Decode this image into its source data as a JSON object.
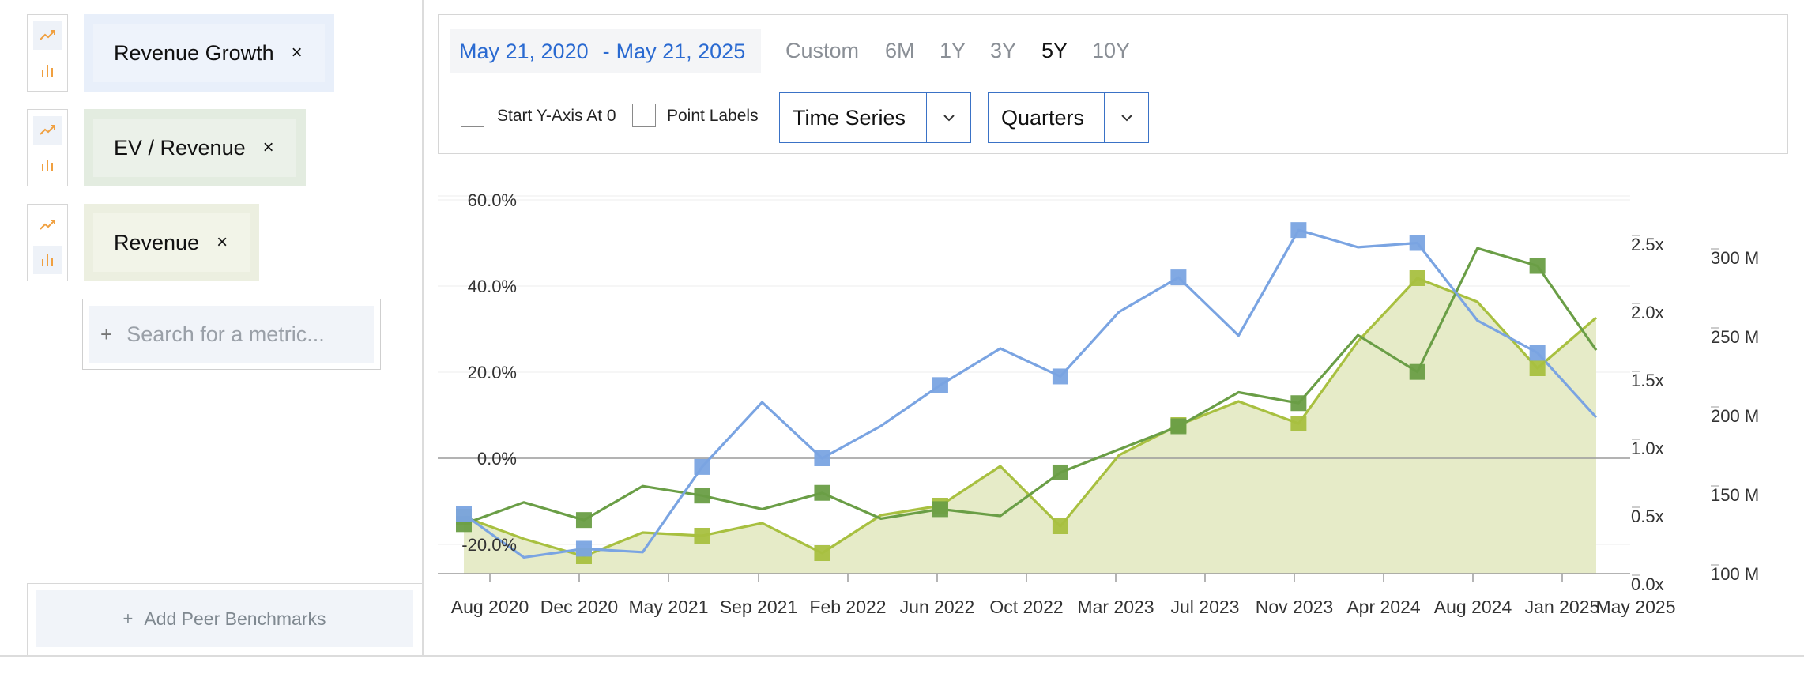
{
  "sidebar": {
    "metrics": [
      {
        "label": "Revenue Growth",
        "chip_bg": "#e8effa",
        "chip_inner": "#eef3fb",
        "close": "×"
      },
      {
        "label": "EV / Revenue",
        "chip_bg": "#e3ece0",
        "chip_inner": "#ebf1e9",
        "close": "×"
      },
      {
        "label": "Revenue",
        "chip_bg": "#ecefe0",
        "chip_inner": "#f2f4e8",
        "close": "×"
      }
    ],
    "search_placeholder": "Search for a metric...",
    "search_plus": "+",
    "peer_label": "Add Peer Benchmarks",
    "peer_plus": "+"
  },
  "controls": {
    "date_start": "May 21, 2020",
    "date_sep": "-",
    "date_end": "May 21, 2025",
    "periods": [
      "Custom",
      "6M",
      "1Y",
      "3Y",
      "5Y",
      "10Y"
    ],
    "active_period": "5Y",
    "start_y_axis_label": "Start Y-Axis At 0",
    "point_labels_label": "Point Labels",
    "chart_mode": "Time Series",
    "frequency": "Quarters"
  },
  "chart_data": {
    "type": "line",
    "x": [
      "2020-06-30",
      "2020-09-30",
      "2020-12-31",
      "2021-03-31",
      "2021-06-30",
      "2021-09-30",
      "2021-12-31",
      "2022-03-31",
      "2022-06-30",
      "2022-09-30",
      "2022-12-31",
      "2023-03-31",
      "2023-06-30",
      "2023-09-30",
      "2023-12-31",
      "2024-03-31",
      "2024-06-30",
      "2024-09-30",
      "2024-12-31",
      "2025-03-31"
    ],
    "x_ticks": [
      "Aug 2020",
      "Dec 2020",
      "May 2021",
      "Sep 2021",
      "Feb 2022",
      "Jun 2022",
      "Oct 2022",
      "Mar 2023",
      "Jul 2023",
      "Nov 2023",
      "Apr 2024",
      "Aug 2024",
      "Jan 2025",
      "May 2025"
    ],
    "series": [
      {
        "name": "Revenue Growth",
        "axis": "left",
        "color": "#7aa4e2",
        "values": [
          -13.0,
          -23.0,
          -21.0,
          -21.8,
          -2.0,
          13.0,
          0.0,
          7.5,
          17.0,
          25.5,
          19.0,
          34.0,
          42.0,
          28.5,
          53.0,
          49.0,
          50.0,
          32.0,
          24.5,
          9.5
        ]
      },
      {
        "name": "EV / Revenue",
        "axis": "right_x",
        "color": "#6a9e46",
        "values": [
          0.44,
          0.6,
          0.47,
          0.72,
          0.65,
          0.55,
          0.67,
          0.48,
          0.55,
          0.5,
          0.82,
          0.99,
          1.16,
          1.41,
          1.33,
          1.83,
          1.56,
          2.47,
          2.34,
          1.72
        ]
      },
      {
        "name": "Revenue",
        "axis": "right_m",
        "color": "#a8c040",
        "fill": "#e6ebc8",
        "values": [
          136,
          122,
          111,
          126,
          124,
          132,
          113,
          137,
          143,
          168,
          130,
          175,
          194,
          209,
          195,
          247,
          287,
          272,
          230,
          262
        ]
      }
    ],
    "left_axis": {
      "ticks": [
        "60.0%",
        "40.0%",
        "20.0%",
        "0.0%",
        "-20.0%"
      ],
      "values": [
        60,
        40,
        20,
        0,
        -20
      ],
      "ylim": [
        -26,
        61
      ]
    },
    "right_axis_x": {
      "ticks": [
        "2.5x",
        "2.0x",
        "1.5x",
        "1.0x",
        "0.5x",
        "0.0x"
      ],
      "values": [
        2.5,
        2.0,
        1.5,
        1.0,
        0.5,
        0.0
      ]
    },
    "right_axis_m": {
      "ticks": [
        "300 M",
        "250 M",
        "200 M",
        "150 M",
        "100 M"
      ],
      "values": [
        300,
        250,
        200,
        150,
        100
      ]
    },
    "grid": true
  }
}
